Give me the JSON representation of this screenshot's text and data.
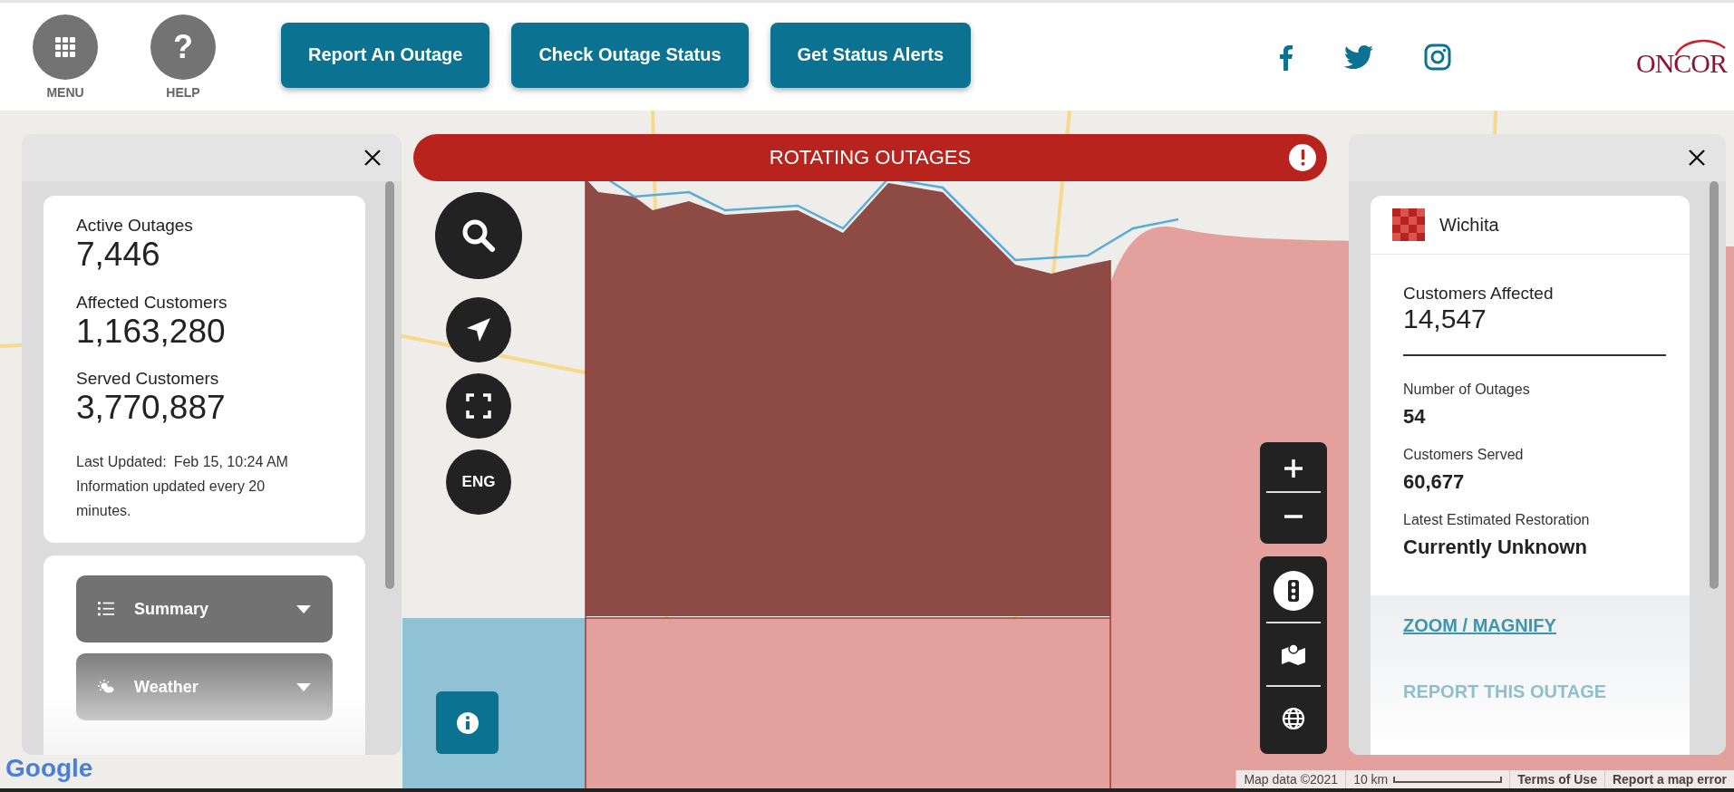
{
  "header": {
    "nav_buttons": [
      {
        "kind": "menu",
        "label": "MENU"
      },
      {
        "kind": "help",
        "label": "HELP",
        "glyph": "?"
      }
    ],
    "actions": [
      "Report An Outage",
      "Check Outage Status",
      "Get Status Alerts"
    ],
    "logo": "ONCOR"
  },
  "banner": {
    "title": "ROTATING OUTAGES"
  },
  "map_controls": {
    "language": "ENG"
  },
  "summary_panel": {
    "stats": [
      {
        "label": "Active Outages",
        "value": "7,446"
      },
      {
        "label": "Affected Customers",
        "value": "1,163,280"
      },
      {
        "label": "Served Customers",
        "value": "3,770,887"
      }
    ],
    "last_updated_label": "Last Updated:",
    "last_updated": "Feb 15, 10:24 AM",
    "note": "Information updated every 20 minutes.",
    "sections": [
      {
        "kind": "summary",
        "label": "Summary"
      },
      {
        "kind": "weather",
        "label": "Weather"
      }
    ]
  },
  "detail_panel": {
    "area": "Wichita",
    "headline": {
      "label": "Customers Affected",
      "value": "14,547"
    },
    "stats": [
      {
        "label": "Number of Outages",
        "value": "54"
      },
      {
        "label": "Customers Served",
        "value": "60,677"
      },
      {
        "label": "Latest Estimated Restoration",
        "value": "Currently Unknown"
      }
    ],
    "links": [
      "ZOOM / MAGNIFY",
      "REPORT THIS OUTAGE"
    ]
  },
  "attribution": {
    "google": "Google",
    "map_data": "Map data ©2021",
    "scale": "10 km",
    "terms": "Terms of Use",
    "report": "Report a map error"
  }
}
